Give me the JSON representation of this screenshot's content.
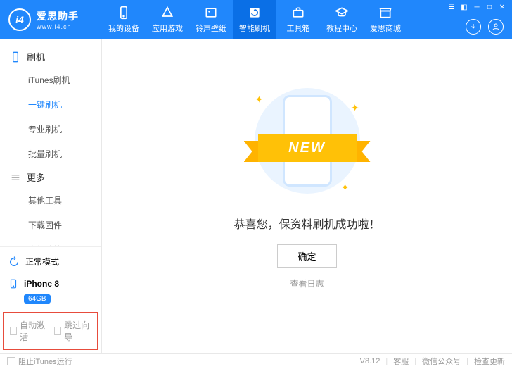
{
  "brand": {
    "logo_text": "i4",
    "title": "爱思助手",
    "subtitle": "www.i4.cn"
  },
  "nav": [
    {
      "label": "我的设备"
    },
    {
      "label": "应用游戏"
    },
    {
      "label": "铃声壁纸"
    },
    {
      "label": "智能刷机"
    },
    {
      "label": "工具箱"
    },
    {
      "label": "教程中心"
    },
    {
      "label": "爱思商城"
    }
  ],
  "sidebar": {
    "group1": {
      "title": "刷机",
      "items": [
        "iTunes刷机",
        "一键刷机",
        "专业刷机",
        "批量刷机"
      ]
    },
    "group2": {
      "title": "更多",
      "items": [
        "其他工具",
        "下载固件",
        "高级功能"
      ]
    }
  },
  "device": {
    "mode": "正常模式",
    "name": "iPhone 8",
    "storage": "64GB"
  },
  "options": {
    "auto_activate": "自动激活",
    "skip_guide": "跳过向导"
  },
  "main": {
    "ribbon": "NEW",
    "message": "恭喜您，保资料刷机成功啦！",
    "ok": "确定",
    "view_log": "查看日志"
  },
  "footer": {
    "block_itunes": "阻止iTunes运行",
    "version": "V8.12",
    "support": "客服",
    "wechat": "微信公众号",
    "update": "检查更新"
  }
}
